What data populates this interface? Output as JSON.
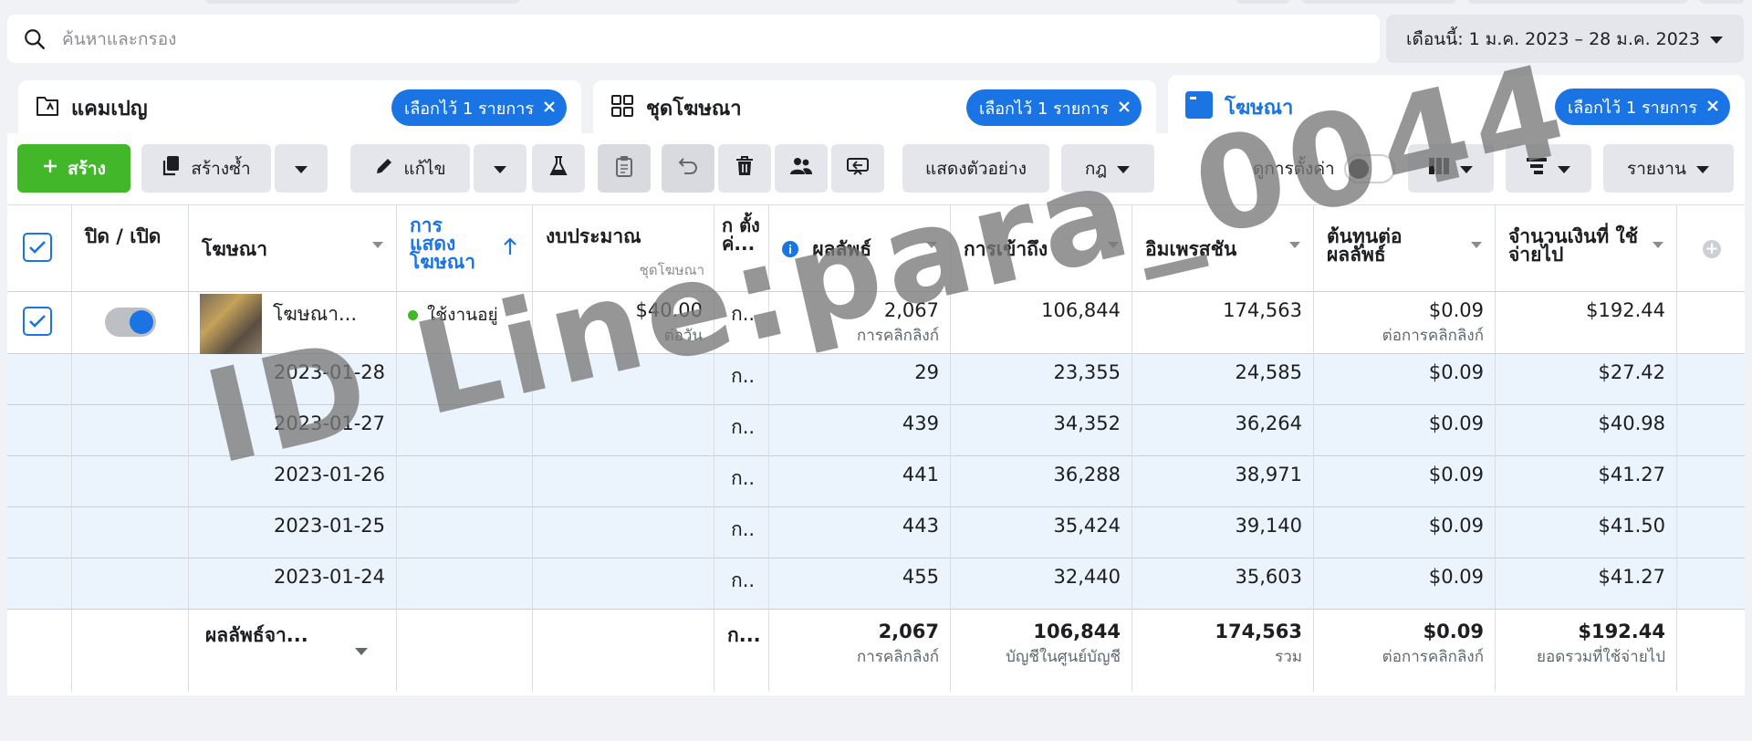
{
  "search": {
    "placeholder": "ค้นหาและกรอง"
  },
  "date_range": {
    "label": "เดือนนี้: 1 ม.ค. 2023 – 28 ม.ค. 2023"
  },
  "levels": [
    {
      "title": "แคมเปญ",
      "selected": "เลือกไว้ 1 รายการ"
    },
    {
      "title": "ชุดโฆษณา",
      "selected": "เลือกไว้ 1 รายการ"
    },
    {
      "title": "โฆษณา",
      "selected": "เลือกไว้ 1 รายการ"
    }
  ],
  "toolbar": {
    "create": "สร้าง",
    "duplicate": "สร้างซ้ำ",
    "edit": "แก้ไข",
    "preview": "แสดงตัวอย่าง",
    "rules": "กฎ",
    "view_setup": "ดูการตั้งค่า",
    "reports": "รายงาน"
  },
  "table": {
    "headers": {
      "onoff": "ปิด / เปิด",
      "ad": "โฆษณา",
      "delivery": "การ แสดง โฆษณา",
      "budget": "งบประมาณ",
      "budget_sub": "ชุดโฆษณา",
      "attribution": "ก ตั้ง ค่...",
      "results": "ผลลัพธ์",
      "reach": "การเข้าถึง",
      "impressions": "อิมเพรสชัน",
      "cpr": "ต้นทุนต่อ ผลลัพธ์",
      "spent": "จำนวนเงินที่ ใช้จ่ายไป"
    },
    "ad_row": {
      "name": "โฆษณา...",
      "delivery": "ใช้งานอยู่",
      "budget": "$40.00",
      "budget_sub": "ต่อวัน",
      "attribution": "ก..",
      "results": "2,067",
      "results_sub": "การคลิกลิงก์",
      "reach": "106,844",
      "impressions": "174,563",
      "cpr": "$0.09",
      "cpr_sub": "ต่อการคลิกลิงก์",
      "spent": "$192.44"
    },
    "days": [
      {
        "date": "2023-01-28",
        "attribution": "ก..",
        "results": "29",
        "reach": "23,355",
        "impressions": "24,585",
        "cpr": "$0.09",
        "spent": "$27.42"
      },
      {
        "date": "2023-01-27",
        "attribution": "ก..",
        "results": "439",
        "reach": "34,352",
        "impressions": "36,264",
        "cpr": "$0.09",
        "spent": "$40.98"
      },
      {
        "date": "2023-01-26",
        "attribution": "ก..",
        "results": "441",
        "reach": "36,288",
        "impressions": "38,971",
        "cpr": "$0.09",
        "spent": "$41.27"
      },
      {
        "date": "2023-01-25",
        "attribution": "ก..",
        "results": "443",
        "reach": "35,424",
        "impressions": "39,140",
        "cpr": "$0.09",
        "spent": "$41.50"
      },
      {
        "date": "2023-01-24",
        "attribution": "ก..",
        "results": "455",
        "reach": "32,440",
        "impressions": "35,603",
        "cpr": "$0.09",
        "spent": "$41.27"
      }
    ],
    "totals": {
      "label": "ผลลัพธ์จา...",
      "attribution": "ก...",
      "results": "2,067",
      "results_sub": "การคลิกลิงก์",
      "reach": "106,844",
      "reach_sub": "บัญชีในศูนย์บัญชี",
      "impressions": "174,563",
      "impressions_sub": "รวม",
      "cpr": "$0.09",
      "cpr_sub": "ต่อการคลิกลิงก์",
      "spent": "$192.44",
      "spent_sub": "ยอดรวมที่ใช้จ่ายไป"
    }
  },
  "watermark": "ID Line:para_0044",
  "colors": {
    "brand": "#1b74e4",
    "create": "#42b72a",
    "active_dot": "#42b72a",
    "day_row": "#ebf3fd"
  }
}
